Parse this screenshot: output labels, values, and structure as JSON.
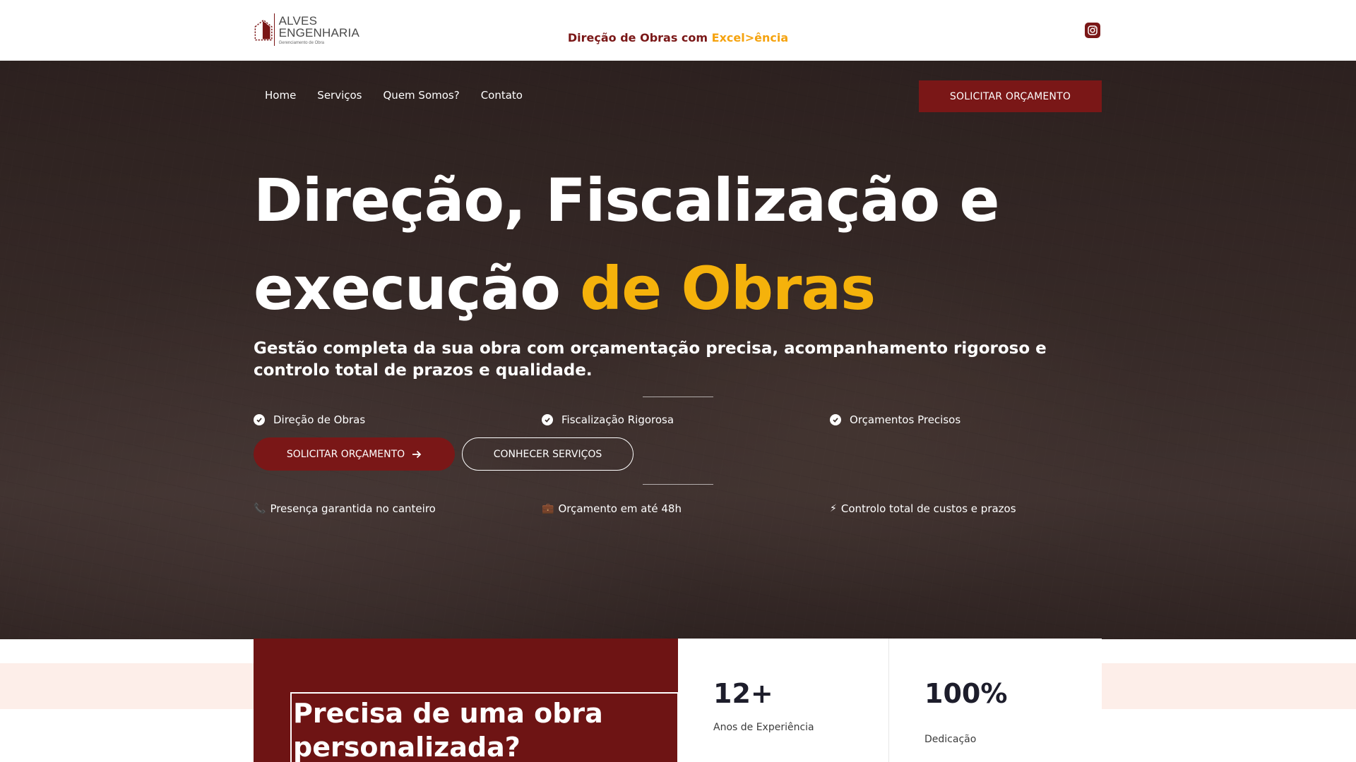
{
  "brand": {
    "line1": "ALVES",
    "line2": "ENGENHARIA",
    "line3": "Gerenciamento de Obra",
    "color": "#7a1717"
  },
  "header": {
    "tagline_prefix": "Direção de Obras com ",
    "tagline_highlight": "Excel>ência",
    "social_icon": "instagram-icon"
  },
  "nav": {
    "items": [
      {
        "label": "Home"
      },
      {
        "label": "Serviços"
      },
      {
        "label": "Quem Somos?"
      },
      {
        "label": "Contato"
      }
    ],
    "cta_label": "SOLICITAR ORÇAMENTO"
  },
  "hero": {
    "headline_line1": "Direção, Fiscalização e",
    "headline_line2_prefix": "execução ",
    "headline_line2_highlight": "de Obras",
    "subheadline": "Gestão completa da sua obra com orçamentação precisa, acompanhamento rigoroso e controlo total de prazos e qualidade.",
    "features": [
      {
        "label": "Direção de Obras",
        "icon": "check-circle-icon"
      },
      {
        "label": "Fiscalização Rigorosa",
        "icon": "check-circle-icon"
      },
      {
        "label": "Orçamentos Precisos",
        "icon": "check-circle-icon"
      }
    ],
    "primary_button": "SOLICITAR ORÇAMENTO",
    "secondary_button": "CONHECER SERVIÇOS",
    "assurances": [
      {
        "icon": "phone-icon",
        "emoji": "📞",
        "label": "Presença garantida no canteiro"
      },
      {
        "icon": "briefcase-icon",
        "emoji": "💼",
        "label": "Orçamento em até 48h"
      },
      {
        "icon": "lightning-icon",
        "emoji": "⚡",
        "label": "Controlo total de custos e prazos"
      }
    ],
    "accent_color": "#f5b20b"
  },
  "promo": {
    "title": "Precisa de uma obra personalizada?"
  },
  "stats": [
    {
      "value": "12+",
      "label": "Anos de Experiência"
    },
    {
      "value": "100%",
      "label": "Dedicação"
    }
  ]
}
